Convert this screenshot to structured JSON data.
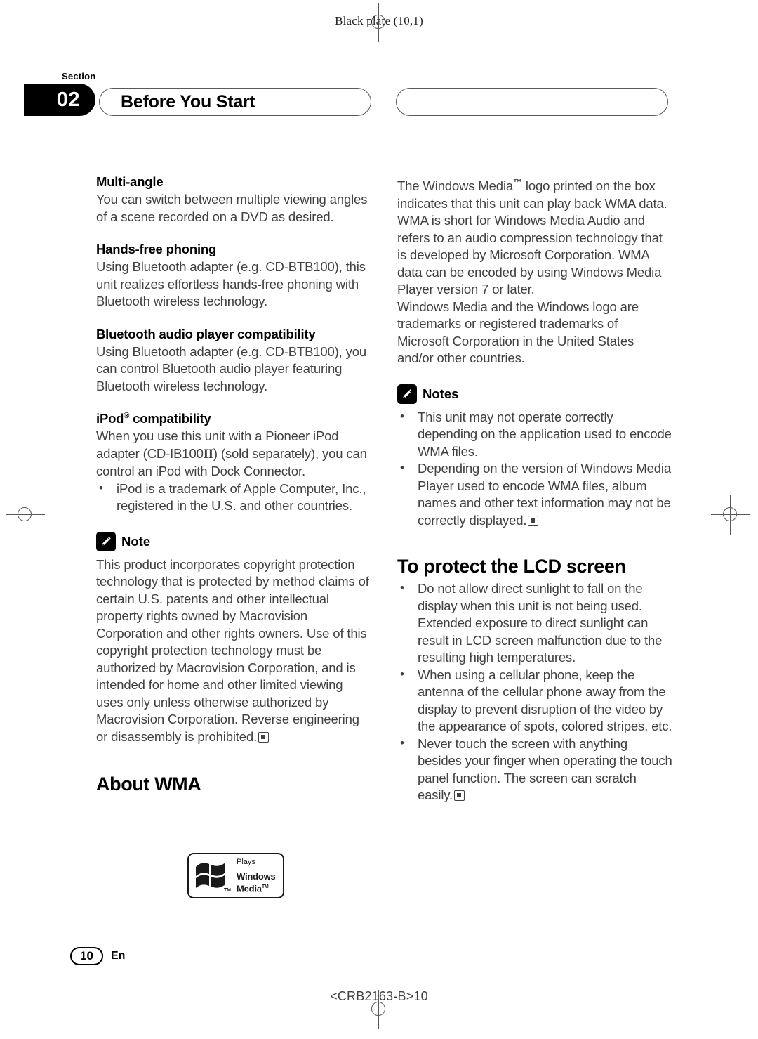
{
  "print_marks": {
    "plate_label": "Black plate (10,1)"
  },
  "header": {
    "section_word": "Section",
    "section_number": "02",
    "chapter_title": "Before You Start"
  },
  "left_column": {
    "multi_angle": {
      "heading": "Multi-angle",
      "body": "You can switch between multiple viewing angles of a scene recorded on a DVD as desired."
    },
    "hands_free": {
      "heading": "Hands-free phoning",
      "body": "Using Bluetooth adapter (e.g. CD-BTB100), this unit realizes effortless hands-free phoning with Bluetooth wireless technology."
    },
    "bt_audio": {
      "heading": "Bluetooth audio player compatibility",
      "body": "Using Bluetooth adapter (e.g. CD-BTB100), you can control Bluetooth audio player featuring Bluetooth wireless technology."
    },
    "ipod": {
      "heading_part1": "iPod",
      "heading_reg": "®",
      "heading_part2": " compatibility",
      "body_part1": "When you use this unit with a Pioneer iPod adapter (CD-IB100",
      "body_roman": "II",
      "body_part2": ") (sold separately), you can control an iPod with Dock Connector.",
      "bullets": [
        "iPod is a trademark of Apple Computer, Inc., registered in the U.S. and other countries."
      ]
    },
    "note": {
      "icon": "pencil-icon",
      "label": "Note",
      "body": "This product incorporates copyright protection technology that is protected by method claims of certain U.S. patents and other intellectual property rights owned by Macrovision Corporation and other rights owners. Use of this copyright protection technology must be authorized by Macrovision Corporation, and is intended for home and other limited viewing uses only unless otherwise authorized by Macrovision Corporation. Reverse engineering or disassembly is prohibited."
    },
    "about_wma_heading": "About WMA",
    "wma_logo": {
      "plays": "Plays",
      "windows": "Windows",
      "media": "Media",
      "media_tm": "TM",
      "flag_tm": "TM"
    }
  },
  "right_column": {
    "intro_part1": "The Windows Media",
    "intro_tm": "™",
    "intro_part2": " logo printed on the box indicates that this unit can play back WMA data.",
    "paragraph2": "WMA is short for Windows Media Audio and refers to an audio compression technology that is developed by Microsoft Corporation. WMA data can be encoded by using Windows Media Player version 7 or later.",
    "paragraph3": "Windows Media and the Windows logo are trademarks or registered trademarks of Microsoft Corporation in the United States and/or other countries.",
    "notes": {
      "icon": "pencil-icon",
      "label": "Notes",
      "bullets": [
        "This unit may not operate correctly depending on the application used to encode WMA files.",
        "Depending on the version of Windows Media Player used to encode WMA files, album names and other text information may not be correctly displayed."
      ]
    },
    "lcd_section": {
      "heading": "To protect the LCD screen",
      "bullets": [
        "Do not allow direct sunlight to fall on the display when this unit is not being used. Extended exposure to direct sunlight can result in LCD screen malfunction due to the resulting high temperatures.",
        "When using a cellular phone, keep the antenna of the cellular phone away from the display to prevent disruption of the video by the appearance of spots, colored stripes, etc.",
        "Never touch the screen with anything besides your finger when operating the touch panel function. The screen can scratch easily."
      ]
    }
  },
  "footer": {
    "page_number": "10",
    "language": "En",
    "document_code": "<CRB2163-B>10"
  },
  "colors": {
    "text": "#414042",
    "heading": "#000000",
    "mark": "#58595b"
  }
}
